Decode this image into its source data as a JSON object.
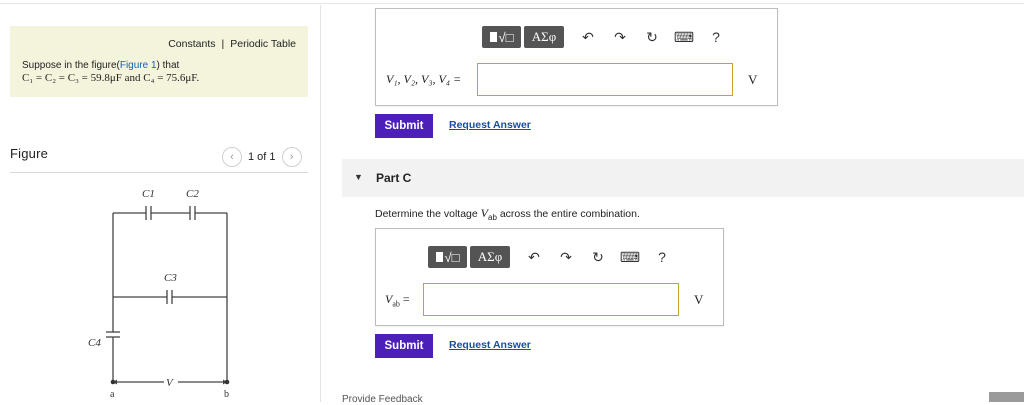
{
  "left": {
    "links": {
      "constants": "Constants",
      "separator": "|",
      "periodic_table": "Periodic Table"
    },
    "problem": {
      "line1_prefix": "Suppose in the figure(",
      "line1_link": "Figure 1",
      "line1_suffix": ") that",
      "line2": "C₁ = C₂ = C₃ = 59.8μF and C₄ = 75.6μF."
    },
    "figure": {
      "title": "Figure",
      "pager_text": "1 of 1",
      "labels": {
        "c1": "C1",
        "c2": "C2",
        "c3": "C3",
        "c4": "C4",
        "v": "V",
        "a": "a",
        "b": "b"
      }
    }
  },
  "part_b": {
    "toolbar": {
      "templates_label": "√□",
      "greek_label": "ΑΣφ",
      "help_label": "?"
    },
    "vars_label": "V₁, V₂, V₃, V₄ =",
    "input_value": "",
    "unit": "V",
    "submit_label": "Submit",
    "request_label": "Request Answer"
  },
  "part_c": {
    "title": "Part C",
    "question_prefix": "Determine the voltage ",
    "question_var": "V",
    "question_sub": "ab",
    "question_suffix": " across the entire combination.",
    "toolbar": {
      "templates_label": "√□",
      "greek_label": "ΑΣφ",
      "help_label": "?"
    },
    "var_label": "V",
    "var_sub": "ab",
    "equals": "=",
    "input_value": "",
    "unit": "V",
    "submit_label": "Submit",
    "request_label": "Request Answer"
  },
  "footer": {
    "feedback_label": "Provide Feedback"
  }
}
